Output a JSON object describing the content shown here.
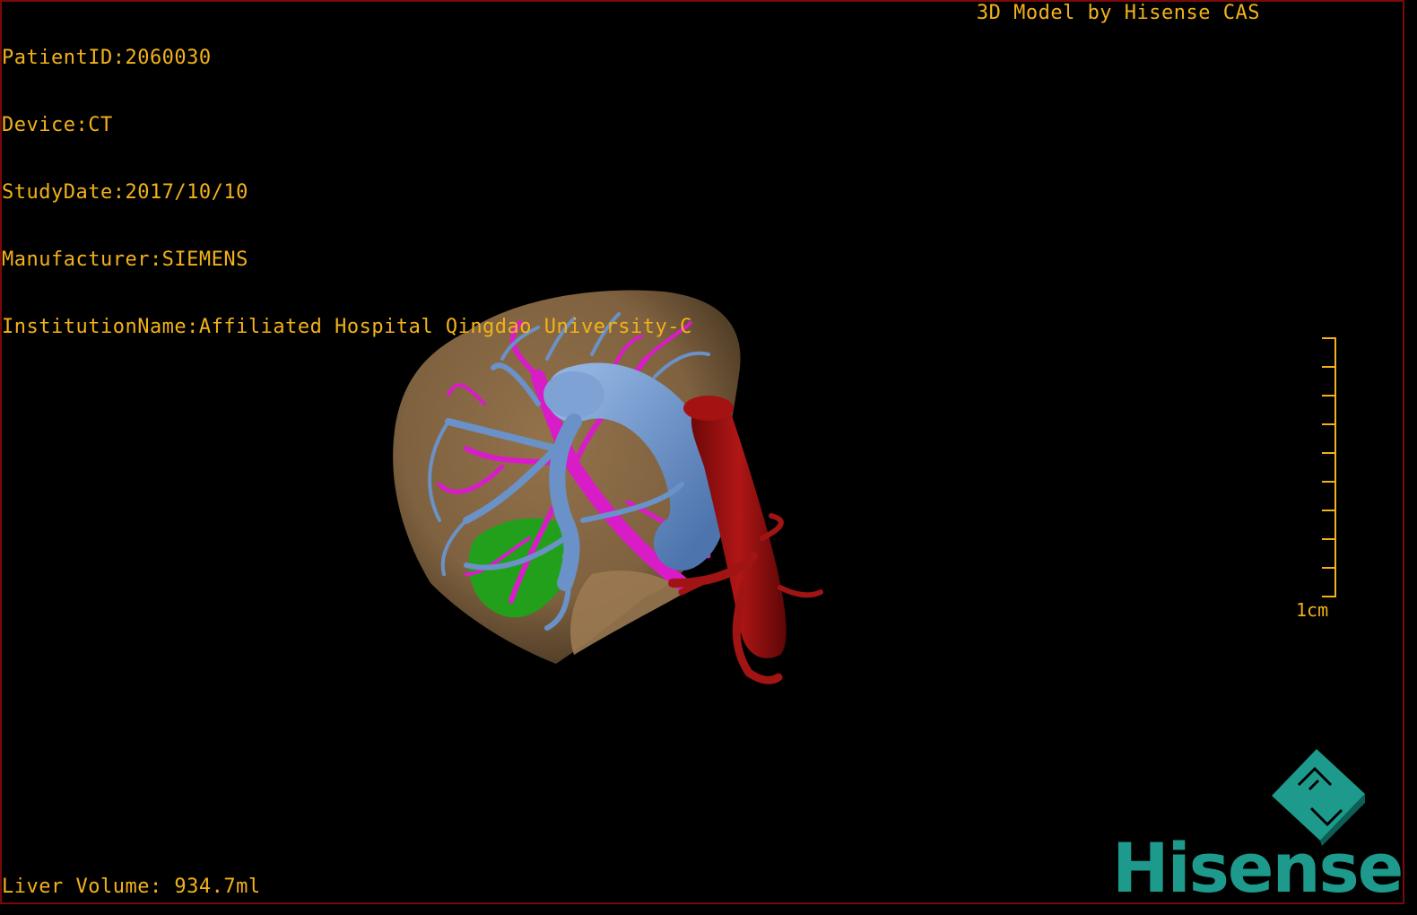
{
  "header": {
    "patient_id": "PatientID:2060030",
    "device": "Device:CT",
    "study_date": "StudyDate:2017/10/10",
    "manufacturer": "Manufacturer:SIEMENS",
    "institution": "InstitutionName:Affiliated Hospital Qingdao University-C"
  },
  "brand_caption": "3D Model by Hisense CAS",
  "scale_bar": {
    "label": "1cm"
  },
  "footer": {
    "liver_volume": "Liver Volume: 934.7ml"
  },
  "logo": {
    "text": "Hisense"
  },
  "colors": {
    "overlay_text": "#f2b21a",
    "liver": "#8a6a45",
    "portal_vein": "#6a92c8",
    "hepatic_artery": "#d81cc8",
    "aorta": "#9b1010",
    "gallbladder": "#22a01c",
    "logo": "#1d9a8c"
  },
  "structures": [
    "liver-surface",
    "portal-vein",
    "hepatic-vein",
    "aorta",
    "gallbladder"
  ]
}
